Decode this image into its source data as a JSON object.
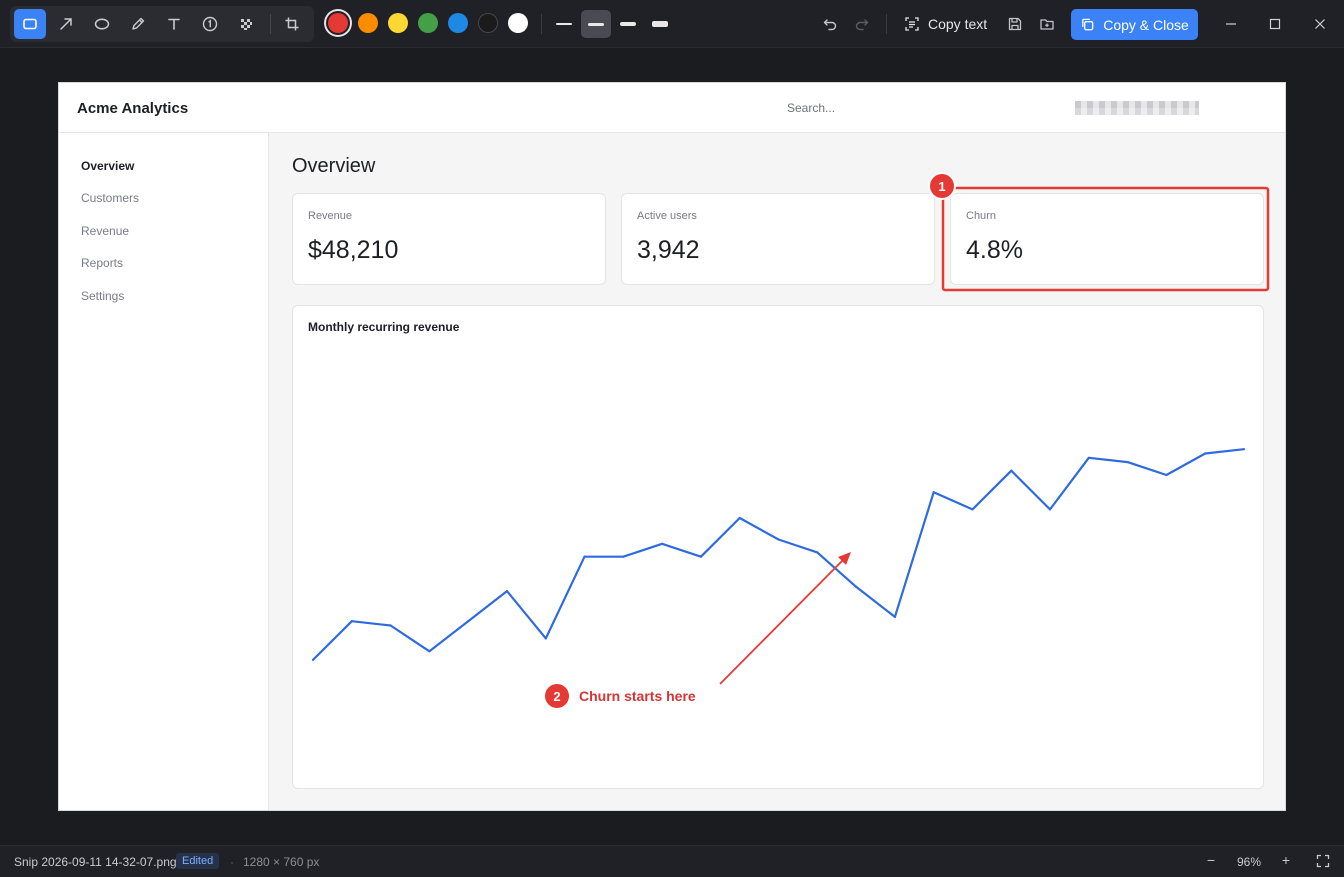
{
  "toolbar": {
    "tools": [
      {
        "name": "rectangle-tool",
        "icon": "rectangle-icon",
        "active": true
      },
      {
        "name": "arrow-tool",
        "icon": "arrow-icon",
        "active": false
      },
      {
        "name": "ellipse-tool",
        "icon": "ellipse-icon",
        "active": false
      },
      {
        "name": "pen-tool",
        "icon": "pen-icon",
        "active": false
      },
      {
        "name": "text-tool",
        "icon": "text-icon",
        "active": false
      },
      {
        "name": "step-number-tool",
        "icon": "numbered-step-icon",
        "active": false
      },
      {
        "name": "pixelate-tool",
        "icon": "pixelate-icon",
        "active": false
      },
      {
        "name": "crop-tool",
        "icon": "crop-icon",
        "active": false
      }
    ],
    "colors": [
      {
        "name": "red",
        "hex": "#e53935",
        "selected": true
      },
      {
        "name": "orange",
        "hex": "#fb8c00",
        "selected": false
      },
      {
        "name": "yellow",
        "hex": "#fdd835",
        "selected": false
      },
      {
        "name": "green",
        "hex": "#43a047",
        "selected": false
      },
      {
        "name": "blue",
        "hex": "#1e88e5",
        "selected": false
      },
      {
        "name": "black",
        "hex": "#1b1b1b",
        "selected": false
      },
      {
        "name": "white",
        "hex": "#ffffff",
        "selected": false
      }
    ],
    "stroke_selected_index": 1,
    "copy_text_label": "Copy text",
    "copy_close_label": "Copy & Close"
  },
  "snip": {
    "header": {
      "brand": "Acme Analytics",
      "search_placeholder": "Search..."
    },
    "sidebar": {
      "items": [
        {
          "label": "Overview",
          "active": true
        },
        {
          "label": "Customers",
          "active": false
        },
        {
          "label": "Revenue",
          "active": false
        },
        {
          "label": "Reports",
          "active": false
        },
        {
          "label": "Settings",
          "active": false
        }
      ]
    },
    "page_title": "Overview",
    "cards": [
      {
        "label": "Revenue",
        "value": "$48,210"
      },
      {
        "label": "Active users",
        "value": "3,942"
      },
      {
        "label": "Churn",
        "value": "4.8%"
      }
    ],
    "chart": {
      "title": "Monthly recurring revenue",
      "line_color": "#2f6be0"
    }
  },
  "annotations": {
    "color": "#e53935",
    "box_badge": "1",
    "arrow_badge": "2",
    "arrow_text": "Churn starts here"
  },
  "chart_data": {
    "type": "line",
    "title": "Monthly recurring revenue",
    "xlabel": "",
    "ylabel": "",
    "grid": false,
    "ylim": [
      0,
      100
    ],
    "series": [
      {
        "values": [
          27,
          36,
          35,
          29,
          36,
          43,
          32,
          51,
          51,
          54,
          51,
          60,
          55,
          52,
          44,
          37,
          66,
          62,
          71,
          62,
          74,
          73,
          70,
          75,
          76
        ]
      }
    ]
  },
  "status": {
    "filename": "Snip 2026-09-11 14-32-07.png",
    "edited_label": "Edited",
    "separator": "·",
    "dimensions": "1280 × 760 px",
    "zoom": "96%",
    "zoom_out_label": "−",
    "zoom_in_label": "+"
  }
}
